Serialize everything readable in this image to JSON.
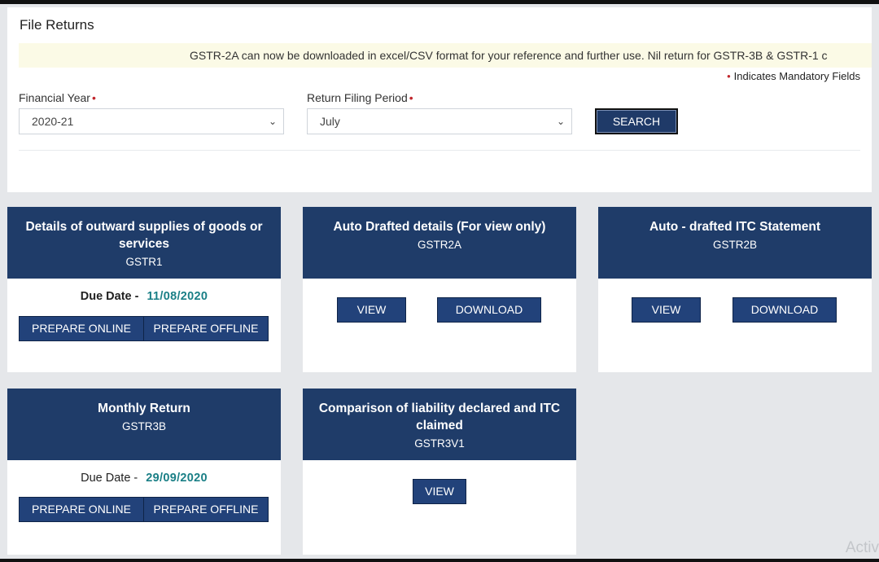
{
  "page": {
    "title": "File Returns",
    "announcement": "GSTR-2A can now be downloaded in excel/CSV format for your reference and further use. Nil return for GSTR-3B & GSTR-1 c",
    "mandatory_note": "Indicates Mandatory Fields",
    "required_marker": "•"
  },
  "filters": {
    "financial_year_label": "Financial Year",
    "financial_year_value": "2020-21",
    "period_label": "Return Filing Period",
    "period_value": "July",
    "search_label": "SEARCH"
  },
  "cards": [
    {
      "title": "Details of outward supplies of goods or services",
      "code": "GSTR1",
      "due_label": "Due Date -",
      "due_date": "11/08/2020",
      "buttons": [
        "PREPARE ONLINE",
        "PREPARE OFFLINE"
      ]
    },
    {
      "title": "Auto Drafted details (For view only)",
      "code": "GSTR2A",
      "buttons": [
        "VIEW",
        "DOWNLOAD"
      ]
    },
    {
      "title": "Auto - drafted ITC Statement",
      "code": "GSTR2B",
      "buttons": [
        "VIEW",
        "DOWNLOAD"
      ]
    },
    {
      "title": "Monthly Return",
      "code": "GSTR3B",
      "due_label": "Due Date -",
      "due_date": "29/09/2020",
      "buttons": [
        "PREPARE ONLINE",
        "PREPARE OFFLINE"
      ]
    },
    {
      "title": "Comparison of liability declared and ITC claimed",
      "code": "GSTR3V1",
      "buttons": [
        "VIEW"
      ]
    }
  ],
  "watermark": "Activ",
  "icons": {
    "dropdown": "chevron-down-icon"
  }
}
